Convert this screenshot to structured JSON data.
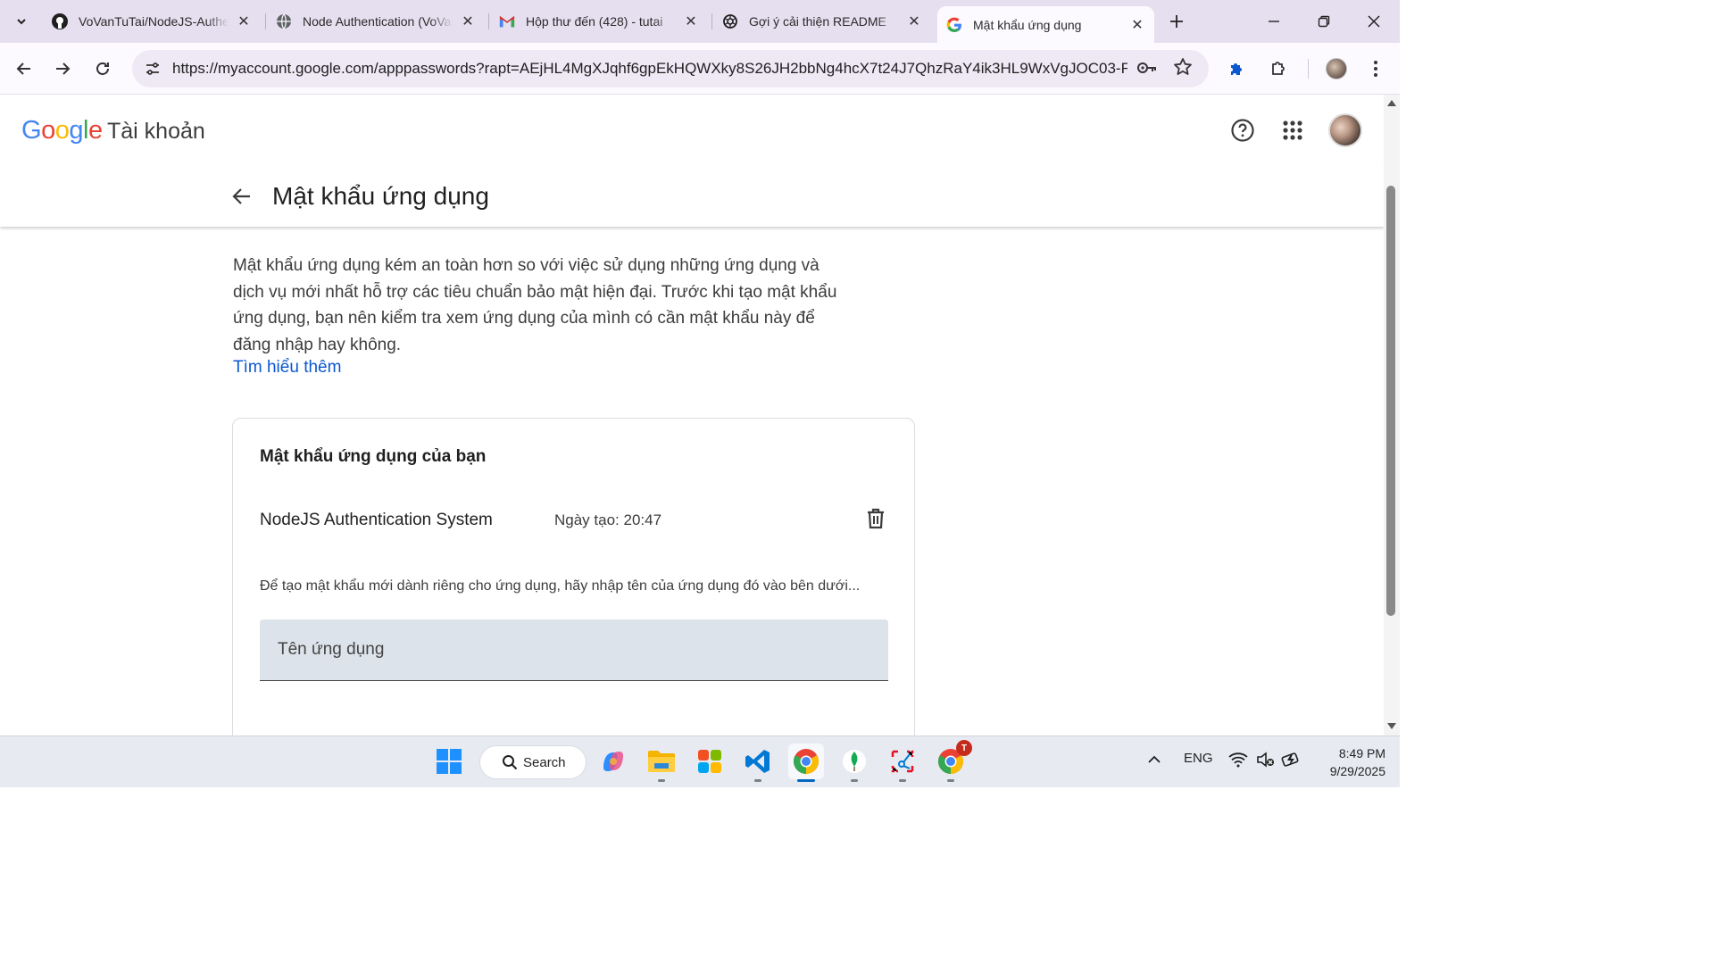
{
  "browser": {
    "tabs": [
      {
        "title": "VoVanTuTai/NodeJS-Authentication",
        "icon": "github-icon"
      },
      {
        "title": "Node Authentication (VoVanTuTai)",
        "icon": "globe-icon"
      },
      {
        "title": "Hộp thư đến (428) - tutai",
        "icon": "gmail-icon"
      },
      {
        "title": "Gợi ý cải thiện README",
        "icon": "chatgpt-icon"
      },
      {
        "title": "Mật khẩu ứng dụng",
        "icon": "google-icon"
      }
    ],
    "active_tab_index": 4,
    "url": "https://myaccount.google.com/apppasswords?rapt=AEjHL4MgXJqhf6gpEkHQWXky8S26JH2bbNg4hcX7t24J7QhzRaY4ik3HL9WxVgJOC03-F..."
  },
  "header": {
    "logo": {
      "G": "G",
      "o1": "o",
      "o2": "o",
      "g": "g",
      "l": "l",
      "e": "e"
    },
    "product": "Tài khoản"
  },
  "subheader": {
    "title": "Mật khẩu ứng dụng"
  },
  "content": {
    "description": "Mật khẩu ứng dụng kém an toàn hơn so với việc sử dụng những ứng dụng và dịch vụ mới nhất hỗ trợ các tiêu chuẩn bảo mật hiện đại. Trước khi tạo mật khẩu ứng dụng, bạn nên kiểm tra xem ứng dụng của mình có cần mật khẩu này để đăng nhập hay không.",
    "learn_more": "Tìm hiểu thêm",
    "card": {
      "title": "Mật khẩu ứng dụng của bạn",
      "passwords": [
        {
          "name": "NodeJS Authentication System",
          "created": "Ngày tạo: 20:47"
        }
      ],
      "hint": "Để tạo mật khẩu mới dành riêng cho ứng dụng, hãy nhập tên của ứng dụng đó vào bên dưới...",
      "input_placeholder": "Tên ứng dụng",
      "input_value": ""
    }
  },
  "taskbar": {
    "search_label": "Search",
    "language": "ENG",
    "time": "8:49 PM",
    "date": "9/29/2025",
    "chrome_badge": "T"
  },
  "colors": {
    "google_blue": "#4285F4",
    "google_red": "#EA4335",
    "google_yellow": "#FBBC05",
    "google_green": "#34A853",
    "link": "#0b57d0",
    "tabstrip": "#e6dff0",
    "input_bg": "#dde3ea"
  }
}
